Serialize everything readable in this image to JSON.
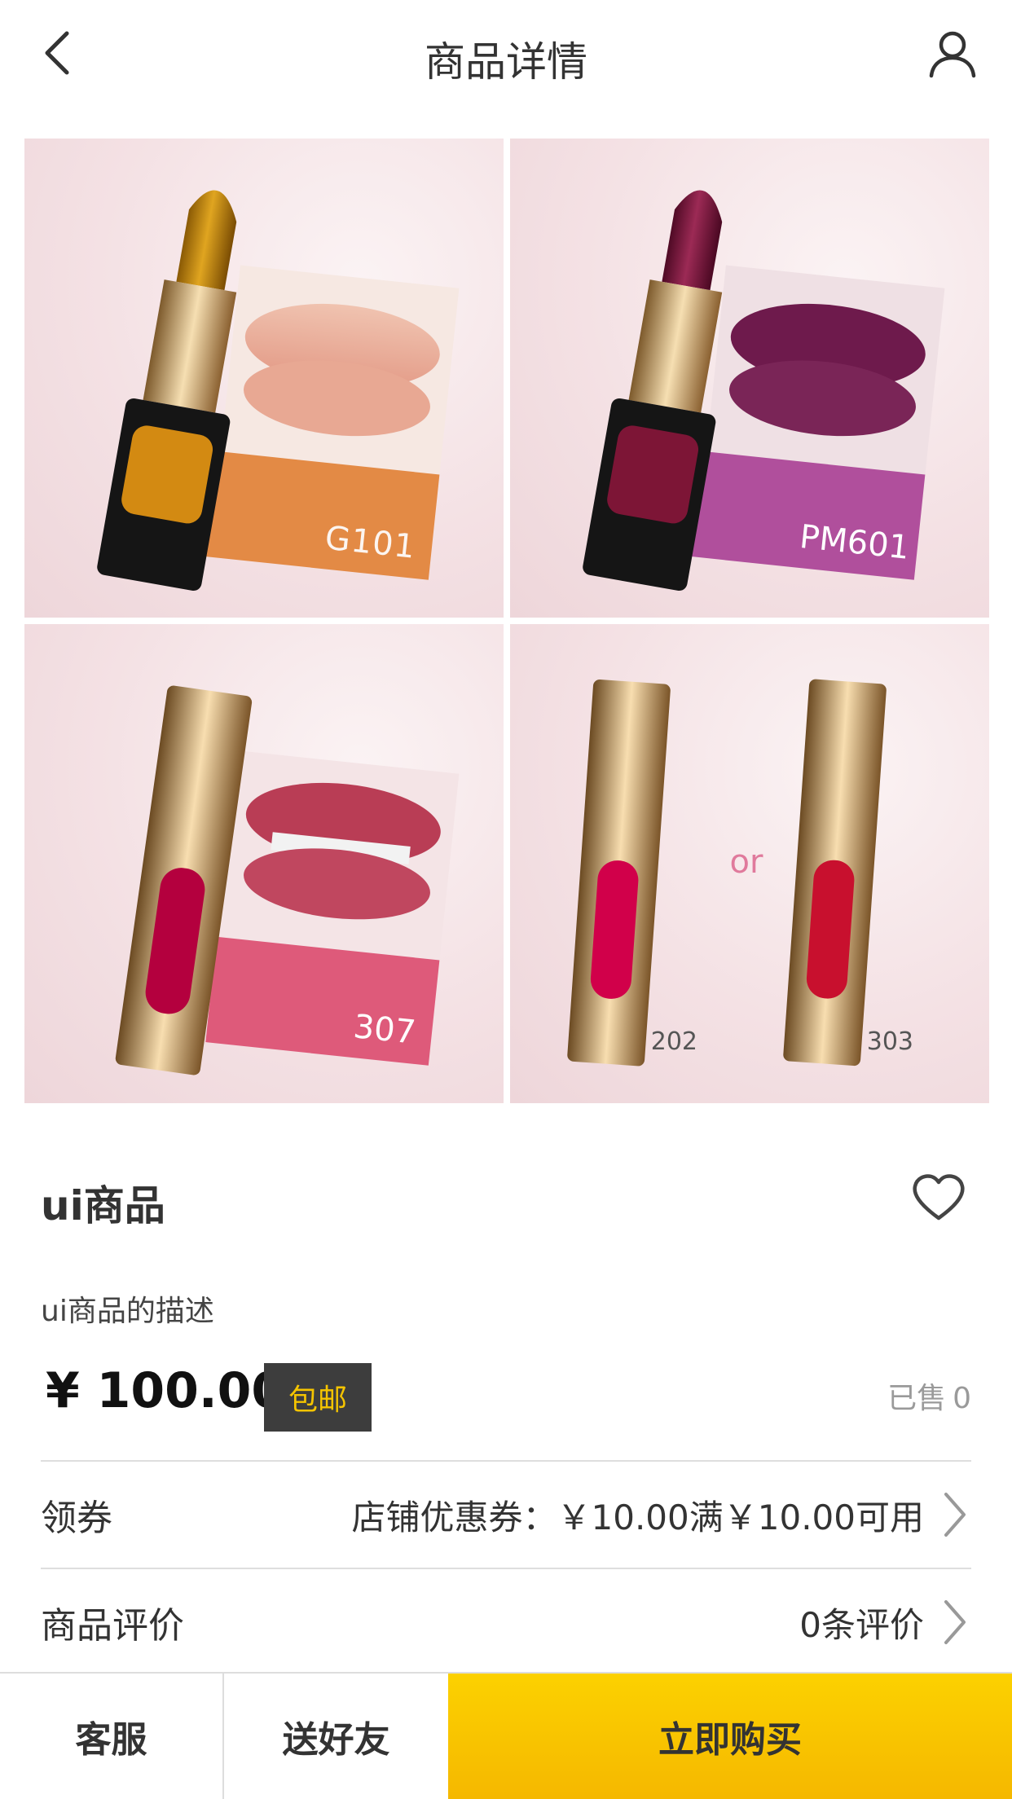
{
  "header": {
    "title": "商品详情",
    "back_icon": "chevron-left-icon",
    "user_icon": "user-icon"
  },
  "gallery": {
    "tiles": [
      {
        "swatch_label": "G101"
      },
      {
        "swatch_label": "PM601"
      },
      {
        "swatch_label": "307"
      },
      {
        "left_label": "202",
        "middle_label": "or",
        "right_label": "303"
      }
    ]
  },
  "product": {
    "name": "ui商品",
    "description": "ui商品的描述",
    "price": "¥ 100.00",
    "shipping_badge": "包邮",
    "sold_label": "已售",
    "sold_count": "0",
    "favorite_icon": "heart-outline-icon"
  },
  "coupon": {
    "label": "领券",
    "value": "店铺优惠券：￥10.00满￥10.00可用"
  },
  "reviews": {
    "label": "商品评价",
    "value": "0条评价"
  },
  "bottom_bar": {
    "service_label": "客服",
    "gift_label": "送好友",
    "buy_label": "立即购买"
  },
  "colors": {
    "accent_yellow": "#f5b800",
    "badge_bg": "#3d3d3d",
    "badge_text": "#f5c400"
  }
}
